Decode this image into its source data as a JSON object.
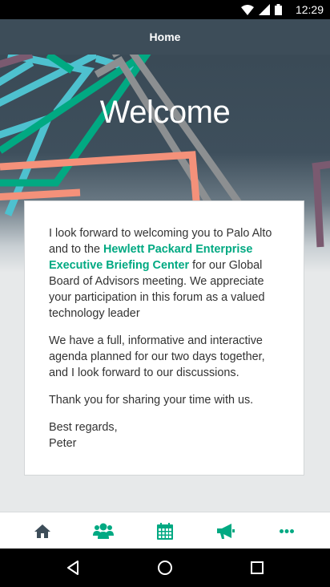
{
  "status_bar": {
    "time": "12:29"
  },
  "app_bar": {
    "title": "Home"
  },
  "hero": {
    "title": "Welcome"
  },
  "card": {
    "p1_before": "I look forward to welcoming you to Palo Alto and to the ",
    "p1_link": "Hewlett Packard Enterprise Executive Briefing Center",
    "p1_after": " for our Global Board of Advisors meeting. We appreciate your participation in this forum as a valued technology leader",
    "p2": "We have a full, informative and interactive agenda planned for our two days together, and I look forward to our discussions.",
    "p3": "Thank you for sharing your time with us.",
    "signoff": "Best regards,",
    "signature": "Peter"
  },
  "tabs": [
    {
      "icon": "home-icon"
    },
    {
      "icon": "people-icon"
    },
    {
      "icon": "calendar-icon"
    },
    {
      "icon": "megaphone-icon"
    },
    {
      "icon": "more-icon"
    }
  ],
  "colors": {
    "accent": "#01a982",
    "home_tab": "#3d4d59",
    "app_bar": "#3d4d59"
  }
}
